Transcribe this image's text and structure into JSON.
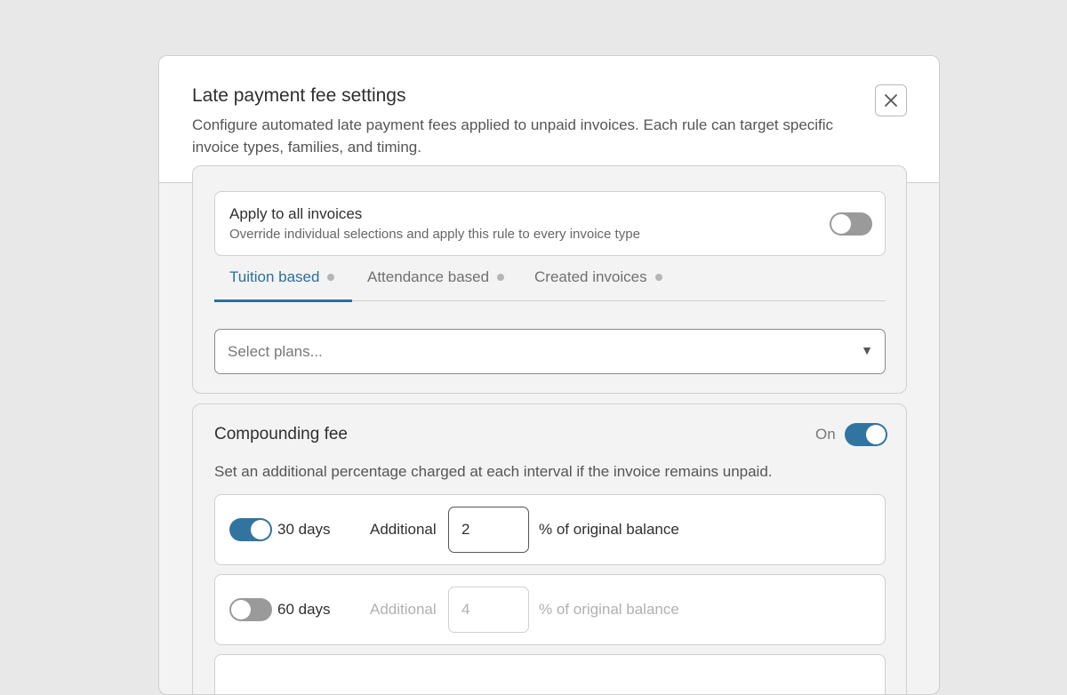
{
  "modal": {
    "title": "Late payment fee settings",
    "description": "Configure automated late payment fees applied to unpaid invoices. Each rule can target specific invoice types, families, and timing.",
    "close_icon": "close-icon"
  },
  "apply_all": {
    "title": "Apply to all invoices",
    "subtitle": "Override individual selections and apply this rule to every invoice type",
    "enabled": false
  },
  "tabs": [
    {
      "label": "Tuition based",
      "active": true
    },
    {
      "label": "Attendance based",
      "active": false
    },
    {
      "label": "Created invoices",
      "active": false
    }
  ],
  "plans_select": {
    "placeholder": "Select plans...",
    "arrow": "▼"
  },
  "compounding": {
    "title": "Compounding fee",
    "state_label": "On",
    "enabled": true,
    "description": "Set an additional percentage charged at each interval if the invoice remains unpaid.",
    "intervals": [
      {
        "days": "30 days",
        "additional_label": "Additional",
        "value": "2",
        "suffix": "% of original balance",
        "enabled": true
      },
      {
        "days": "60 days",
        "additional_label": "Additional",
        "value": "4",
        "suffix": "% of original balance",
        "enabled": false
      }
    ]
  },
  "colors": {
    "accent": "#2b6f9a",
    "toggle_on": "#3274a0",
    "toggle_off": "#9a9a9a",
    "background": "#e8e8e8"
  }
}
